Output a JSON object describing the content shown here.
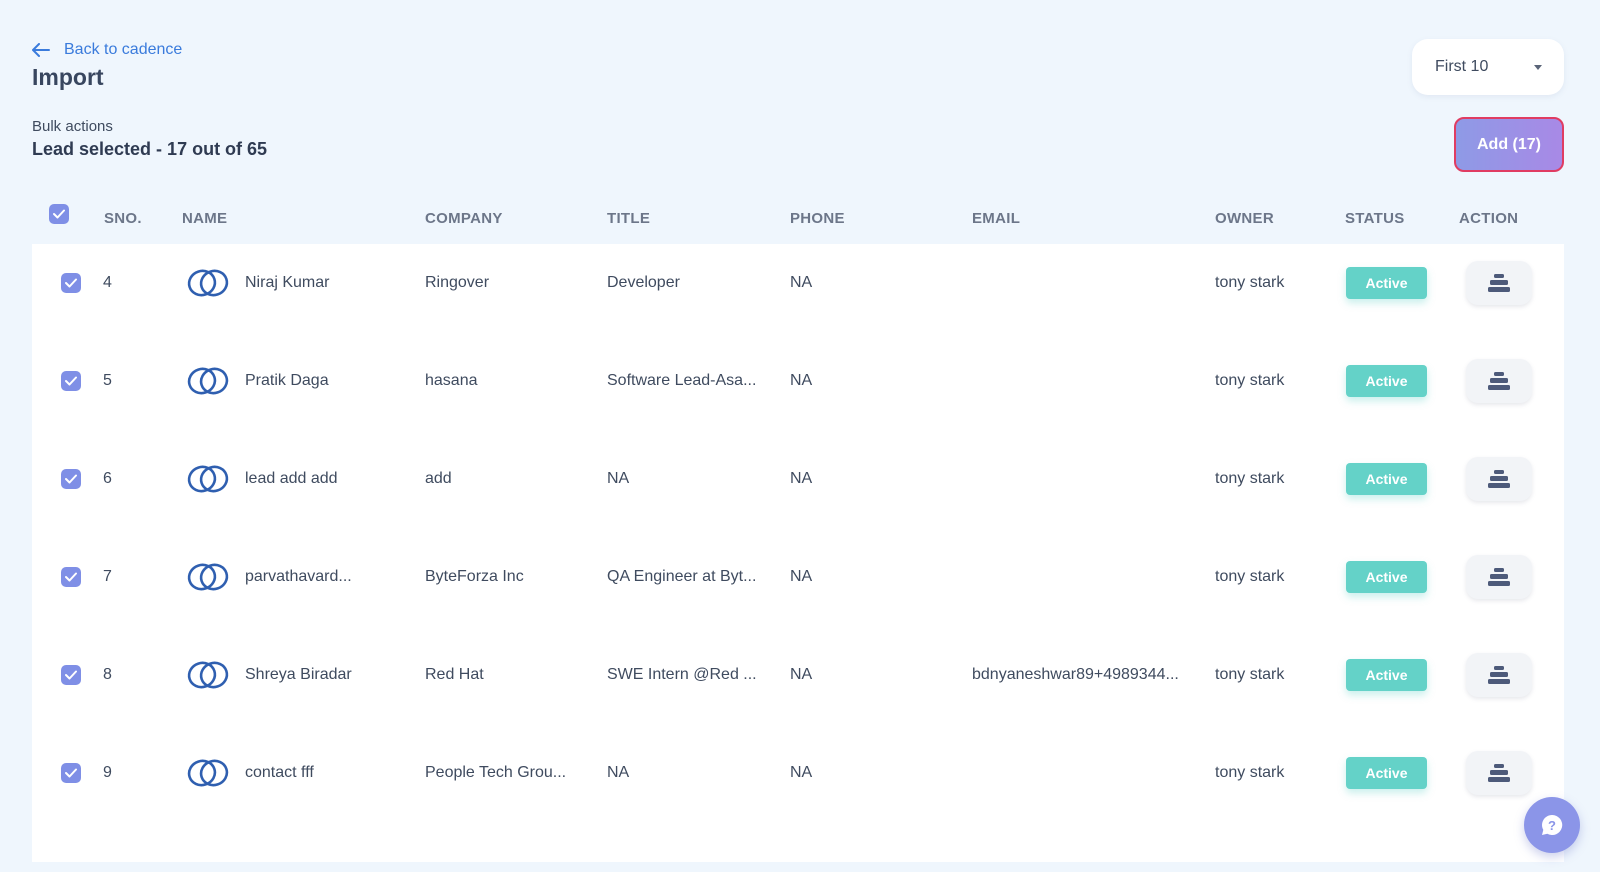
{
  "header": {
    "back_label": "Back to cadence",
    "title": "Import",
    "bulk_label": "Bulk actions",
    "lead_selected": "Lead selected - 17 out of 65",
    "range_select": "First 10",
    "add_button": "Add (17)"
  },
  "table": {
    "columns": [
      "SNO.",
      "NAME",
      "COMPANY",
      "TITLE",
      "PHONE",
      "EMAIL",
      "OWNER",
      "STATUS",
      "ACTION"
    ],
    "rows": [
      {
        "sno": "4",
        "name": "Niraj Kumar",
        "company": "Ringover",
        "title": "Developer",
        "phone": "NA",
        "email": "",
        "owner": "tony stark",
        "status": "Active"
      },
      {
        "sno": "5",
        "name": "Pratik Daga",
        "company": "hasana",
        "title": "Software Lead-Asa...",
        "phone": "NA",
        "email": "",
        "owner": "tony stark",
        "status": "Active"
      },
      {
        "sno": "6",
        "name": "lead add add",
        "company": "add",
        "title": "NA",
        "phone": "NA",
        "email": "",
        "owner": "tony stark",
        "status": "Active"
      },
      {
        "sno": "7",
        "name": "parvathavard...",
        "company": "ByteForza Inc",
        "title": "QA Engineer at Byt...",
        "phone": "NA",
        "email": "",
        "owner": "tony stark",
        "status": "Active"
      },
      {
        "sno": "8",
        "name": "Shreya Biradar",
        "company": "Red Hat",
        "title": "SWE Intern @Red ...",
        "phone": "NA",
        "email": "bdnyaneshwar89+4989344...",
        "owner": "tony stark",
        "status": "Active"
      },
      {
        "sno": "9",
        "name": "contact fff",
        "company": "People Tech Grou...",
        "title": "NA",
        "phone": "NA",
        "email": "",
        "owner": "tony stark",
        "status": "Active"
      }
    ]
  },
  "icons": {
    "back": "arrow-left-icon",
    "select_caret": "caret-down-icon",
    "lead_source": "zoho-crm-logo-icon",
    "action": "stack-icon",
    "help": "chat-help-icon"
  },
  "colors": {
    "background": "#eff6fd",
    "link": "#3a7bdc",
    "checkbox": "#7f8fe6",
    "status_active": "#64d2c8",
    "add_button_border": "#e03c62"
  }
}
